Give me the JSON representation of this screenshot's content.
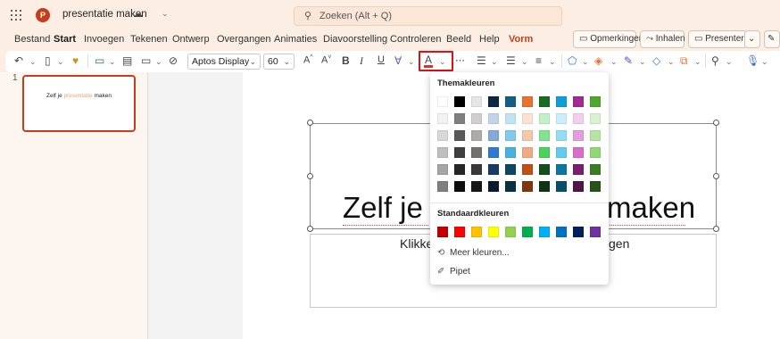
{
  "titlebar": {
    "doc_title": "presentatie maken",
    "search_placeholder": "Zoeken (Alt + Q)",
    "app_badge": "P"
  },
  "menu": {
    "items": [
      "Bestand",
      "Start",
      "Invoegen",
      "Tekenen",
      "Ontwerp",
      "Overgangen",
      "Animaties",
      "Diavoorstelling",
      "Controleren",
      "Beeld",
      "Help",
      "Vorm"
    ],
    "active": "Start",
    "buttons": {
      "comments": "Opmerkingen",
      "catchup": "Inhalen",
      "present": "Presenteren"
    }
  },
  "ribbon": {
    "font_name": "Aptos Display",
    "font_size": "60",
    "bold": "B",
    "italic": "I",
    "underline": "U",
    "grow": "A^",
    "shrink": "A˅",
    "font_color_label": "A",
    "font_color_hex": "#e0302a"
  },
  "thumbnail": {
    "slide_number": "1",
    "text_part1": "Zelf je ",
    "text_part2": "presentatie",
    "text_part3": " maken"
  },
  "slide": {
    "title_left": "Zelf je",
    "title_right": "maken",
    "subtitle_left": "Klikke",
    "subtitle_right": "gen"
  },
  "color_popup": {
    "theme_heading": "Themakleuren",
    "standard_heading": "Standaardkleuren",
    "more_colors": "Meer kleuren...",
    "eyedropper": "Pipet",
    "theme_rows": [
      [
        "#ffffff",
        "#000000",
        "#e7e6e6",
        "#0e2841",
        "#156082",
        "#e97132",
        "#196b24",
        "#0f9ed5",
        "#a02b93",
        "#4ea72e"
      ],
      [
        "#f2f2f2",
        "#7f7f7f",
        "#d0cece",
        "#c0d4ea",
        "#c1e4f5",
        "#fbe2d5",
        "#c1f0c8",
        "#caeefb",
        "#f2cfee",
        "#d9f2d0"
      ],
      [
        "#d8d8d8",
        "#595959",
        "#aeabab",
        "#83a9d6",
        "#83cbeb",
        "#f7c7ac",
        "#83e28e",
        "#95dcf7",
        "#e59edd",
        "#b5e5a2"
      ],
      [
        "#bfbfbf",
        "#3f3f3f",
        "#757070",
        "#2f79d6",
        "#46b1e1",
        "#f2aa84",
        "#47d459",
        "#61cbf3",
        "#d86dcb",
        "#8ed973"
      ],
      [
        "#a5a5a5",
        "#262626",
        "#3a3838",
        "#163c66",
        "#0f4761",
        "#c04f15",
        "#124f1a",
        "#0b76a0",
        "#782070",
        "#3a7d22"
      ],
      [
        "#7f7f7f",
        "#0c0c0c",
        "#171616",
        "#0a1a2c",
        "#0a3041",
        "#80350e",
        "#0d3512",
        "#074f6a",
        "#501549",
        "#275317"
      ]
    ],
    "standard_row": [
      "#c00000",
      "#ff0000",
      "#ffc000",
      "#ffff00",
      "#92d050",
      "#00b050",
      "#00b0f0",
      "#0070c0",
      "#002060",
      "#7030a0"
    ]
  }
}
